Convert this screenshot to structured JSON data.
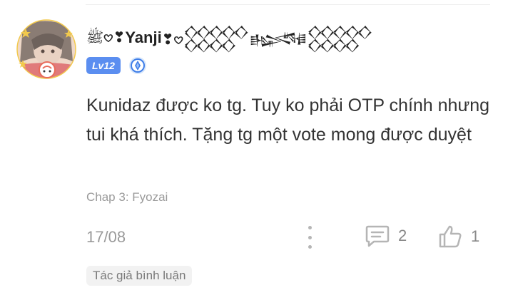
{
  "comment": {
    "username_prefix": "ﷺ𖹭❣",
    "username": "Yanji",
    "username_suffix": "❣𖹭𒐫𒈙𒐫",
    "level_badge": "Lv12",
    "text": "Kunidaz được ko tg. Tuy ko phải OTP chính nhưng tui khá thích. Tặng tg một vote mong được duyệt",
    "chapter": "Chap 3: Fyozai",
    "date": "17/08",
    "reply_count": "2",
    "like_count": "1",
    "author_tag": "Tác giả bình luận"
  },
  "colors": {
    "level_badge": "#5b8ef0",
    "muted_text": "#9a9a9a",
    "icon_gray": "#b5b5b5"
  },
  "icons": {
    "avatar": "anime-avatar",
    "rank": "blue-rank-icon",
    "more": "vertical-dots-icon",
    "reply": "comment-icon",
    "like": "thumbs-up-icon"
  }
}
